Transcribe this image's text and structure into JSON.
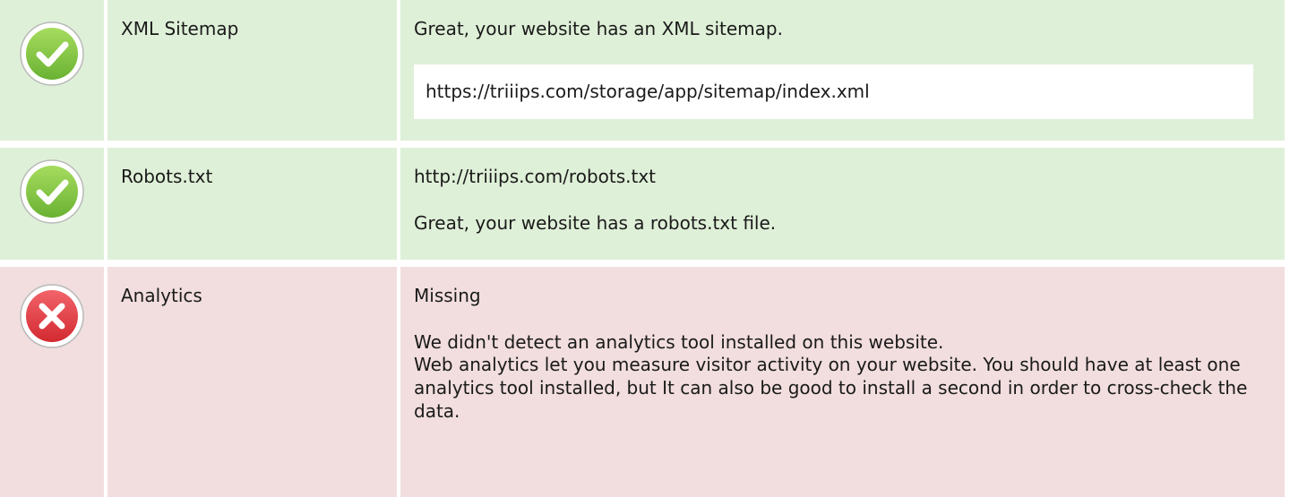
{
  "checks": [
    {
      "status": "ok",
      "icon": "check-circle-icon",
      "name": "XML Sitemap",
      "message": "Great, your website has an XML sitemap.",
      "url": "https://triiips.com/storage/app/sitemap/index.xml"
    },
    {
      "status": "ok",
      "icon": "check-circle-icon",
      "name": "Robots.txt",
      "url": "http://triiips.com/robots.txt",
      "message": "Great, your website has a robots.txt file."
    },
    {
      "status": "fail",
      "icon": "error-circle-icon",
      "name": "Analytics",
      "value": "Missing",
      "message": "We didn't detect an analytics tool installed on this website.",
      "explanation": "Web analytics let you measure visitor activity on your website. You should have at least one analytics tool installed, but It can also be good to install a second in order to cross-check the data."
    }
  ],
  "colors": {
    "ok_background": "#dff0d8",
    "fail_background": "#f2dede",
    "ok_icon": "#7cc242",
    "fail_icon": "#e0353c"
  }
}
